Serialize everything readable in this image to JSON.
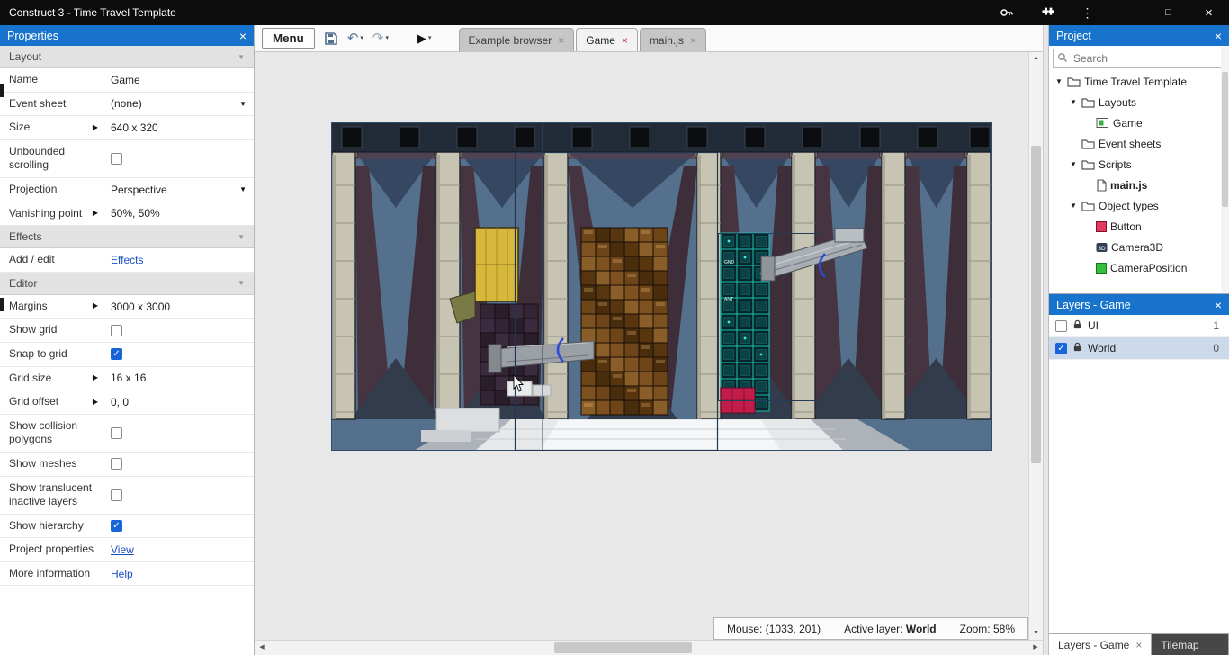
{
  "title_bar": {
    "title": "Construct 3 - Time Travel Template"
  },
  "toolbar": {
    "menu_label": "Menu"
  },
  "tabs": [
    {
      "label": "Example browser",
      "active": false
    },
    {
      "label": "Game",
      "active": true
    },
    {
      "label": "main.js",
      "active": false
    }
  ],
  "properties_panel": {
    "title": "Properties",
    "rows": [
      {
        "type": "section",
        "label": "Layout"
      },
      {
        "type": "text",
        "label": "Name",
        "value": "Game"
      },
      {
        "type": "dropdown",
        "label": "Event sheet",
        "value": "(none)"
      },
      {
        "type": "text",
        "label": "Size",
        "value": "640 x 320",
        "expand": true
      },
      {
        "type": "checkbox",
        "label": "Unbounded scrolling",
        "checked": false
      },
      {
        "type": "dropdown",
        "label": "Projection",
        "value": "Perspective"
      },
      {
        "type": "text",
        "label": "Vanishing point",
        "value": "50%, 50%",
        "expand": true
      },
      {
        "type": "section",
        "label": "Effects"
      },
      {
        "type": "link",
        "label": "Add / edit",
        "value": "Effects"
      },
      {
        "type": "section",
        "label": "Editor"
      },
      {
        "type": "text",
        "label": "Margins",
        "value": "3000 x 3000",
        "expand": true
      },
      {
        "type": "checkbox",
        "label": "Show grid",
        "checked": false
      },
      {
        "type": "checkbox",
        "label": "Snap to grid",
        "checked": true
      },
      {
        "type": "text",
        "label": "Grid size",
        "value": "16 x 16",
        "expand": true
      },
      {
        "type": "text",
        "label": "Grid offset",
        "value": "0, 0",
        "expand": true
      },
      {
        "type": "checkbox",
        "label": "Show collision polygons",
        "checked": false
      },
      {
        "type": "checkbox",
        "label": "Show meshes",
        "checked": false
      },
      {
        "type": "checkbox",
        "label": "Show translucent inactive layers",
        "checked": false
      },
      {
        "type": "checkbox",
        "label": "Show hierarchy",
        "checked": true
      }
    ],
    "footer_rows": [
      {
        "type": "link",
        "label": "Project properties",
        "value": "View"
      },
      {
        "type": "link",
        "label": "More information",
        "value": "Help"
      }
    ]
  },
  "project_panel": {
    "title": "Project",
    "search_placeholder": "Search",
    "tree": [
      {
        "label": "Time Travel Template",
        "icon": "folder",
        "depth": 0,
        "expanded": true
      },
      {
        "label": "Layouts",
        "icon": "folder",
        "depth": 1,
        "expanded": true
      },
      {
        "label": "Game",
        "icon": "layout",
        "depth": 2
      },
      {
        "label": "Event sheets",
        "icon": "folder",
        "depth": 1
      },
      {
        "label": "Scripts",
        "icon": "folder",
        "depth": 1,
        "expanded": true
      },
      {
        "label": "main.js",
        "icon": "file",
        "depth": 2,
        "bold": true
      },
      {
        "label": "Object types",
        "icon": "folder",
        "depth": 1,
        "expanded": true
      },
      {
        "label": "Button",
        "icon": "button",
        "depth": 2
      },
      {
        "label": "Camera3D",
        "icon": "camera3d",
        "depth": 2
      },
      {
        "label": "CameraPosition",
        "icon": "position",
        "depth": 2
      }
    ]
  },
  "layers_panel": {
    "title": "Layers - Game",
    "layers": [
      {
        "name": "UI",
        "index": "1",
        "visible": false,
        "locked": true,
        "selected": false
      },
      {
        "name": "World",
        "index": "0",
        "visible": true,
        "locked": true,
        "selected": true
      }
    ]
  },
  "status_bar": {
    "mouse_label": "Mouse:",
    "mouse_value": "(1033, 201)",
    "active_layer_label": "Active layer:",
    "active_layer_value": "World",
    "zoom_label": "Zoom:",
    "zoom_value": "58%"
  },
  "bottom_tabs": [
    {
      "label": "Layers - Game",
      "closable": true,
      "active": true
    },
    {
      "label": "Tilemap",
      "closable": false,
      "active": false
    }
  ],
  "colors": {
    "panel_header_blue": "#1873cc",
    "checkbox_checked_blue": "#1765d8",
    "selected_layer_row": "#ccd9ea",
    "active_tab_close_red": "#d03838",
    "titlebar_black": "#0c0c0c"
  }
}
